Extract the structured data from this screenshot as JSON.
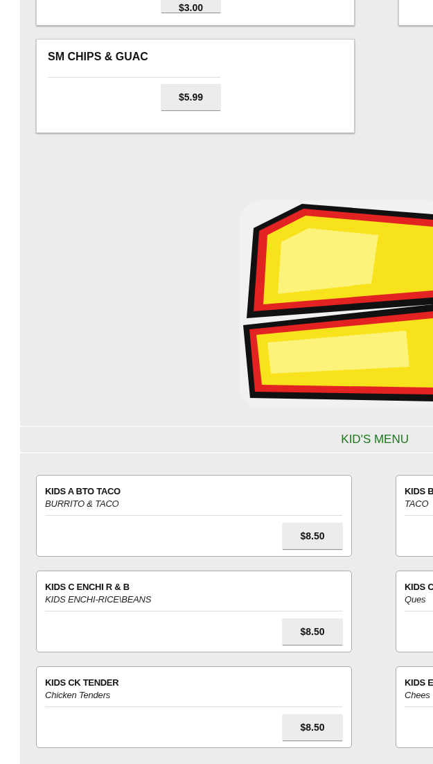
{
  "upper_items": [
    {
      "price": "$3.00"
    },
    {
      "name": "SM CHIPS & GUAC",
      "price": "$5.99"
    }
  ],
  "upper_side_card": {
    "kind": "blank"
  },
  "category": {
    "title": "KID'S MENU"
  },
  "kids_items": [
    {
      "name": "KIDS A BTO TACO",
      "description": "BURRITO & TACO",
      "price": "$8.50"
    },
    {
      "name": "KIDS B",
      "description": "TACO"
    },
    {
      "name": "KIDS C ENCHI R & B",
      "description": "KIDS ENCHI-RICE\\BEANS",
      "price": "$8.50"
    },
    {
      "name": "KIDS C",
      "description": "Ques"
    },
    {
      "name": "KIDS CK TENDER",
      "description": "Chicken Tenders",
      "price": "$8.50"
    },
    {
      "name": "KIDS E",
      "description": "Chees"
    }
  ]
}
